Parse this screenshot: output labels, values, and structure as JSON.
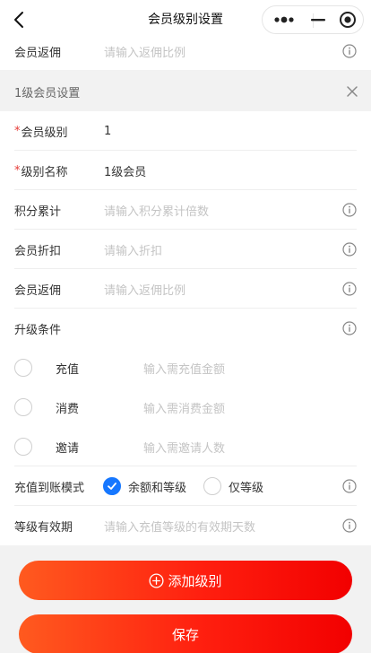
{
  "navbar": {
    "title": "会员级别设置",
    "more_icon": "more-dots-icon",
    "minimize_icon": "minimize-icon",
    "close_icon": "target-close-icon"
  },
  "top_row": {
    "label": "会员返佣",
    "placeholder": "请输入返佣比例"
  },
  "section": {
    "title": "1级会员设置"
  },
  "fields": {
    "level": {
      "label": "会员级别",
      "value": "1",
      "required": "*"
    },
    "level_name": {
      "label": "级别名称",
      "value": "1级会员",
      "required": "*"
    },
    "points": {
      "label": "积分累计",
      "placeholder": "请输入积分累计倍数"
    },
    "discount": {
      "label": "会员折扣",
      "placeholder": "请输入折扣"
    },
    "rebate": {
      "label": "会员返佣",
      "placeholder": "请输入返佣比例"
    },
    "upgrade": {
      "label": "升级条件"
    }
  },
  "conditions": {
    "recharge": {
      "label": "充值",
      "placeholder": "输入需充值金额"
    },
    "consume": {
      "label": "消费",
      "placeholder": "输入需消费金额"
    },
    "invite": {
      "label": "邀请",
      "placeholder": "输入需邀请人数"
    }
  },
  "mode": {
    "label": "充值到账模式",
    "option1": "余额和等级",
    "option2": "仅等级",
    "selected": "余额和等级"
  },
  "validity": {
    "label": "等级有效期",
    "placeholder": "请输入充值等级的有效期天数"
  },
  "buttons": {
    "add_level": "添加级别",
    "save": "保存"
  },
  "colors": {
    "accent": "#ff1f0f",
    "check": "#1677ff",
    "required": "#e53935"
  }
}
